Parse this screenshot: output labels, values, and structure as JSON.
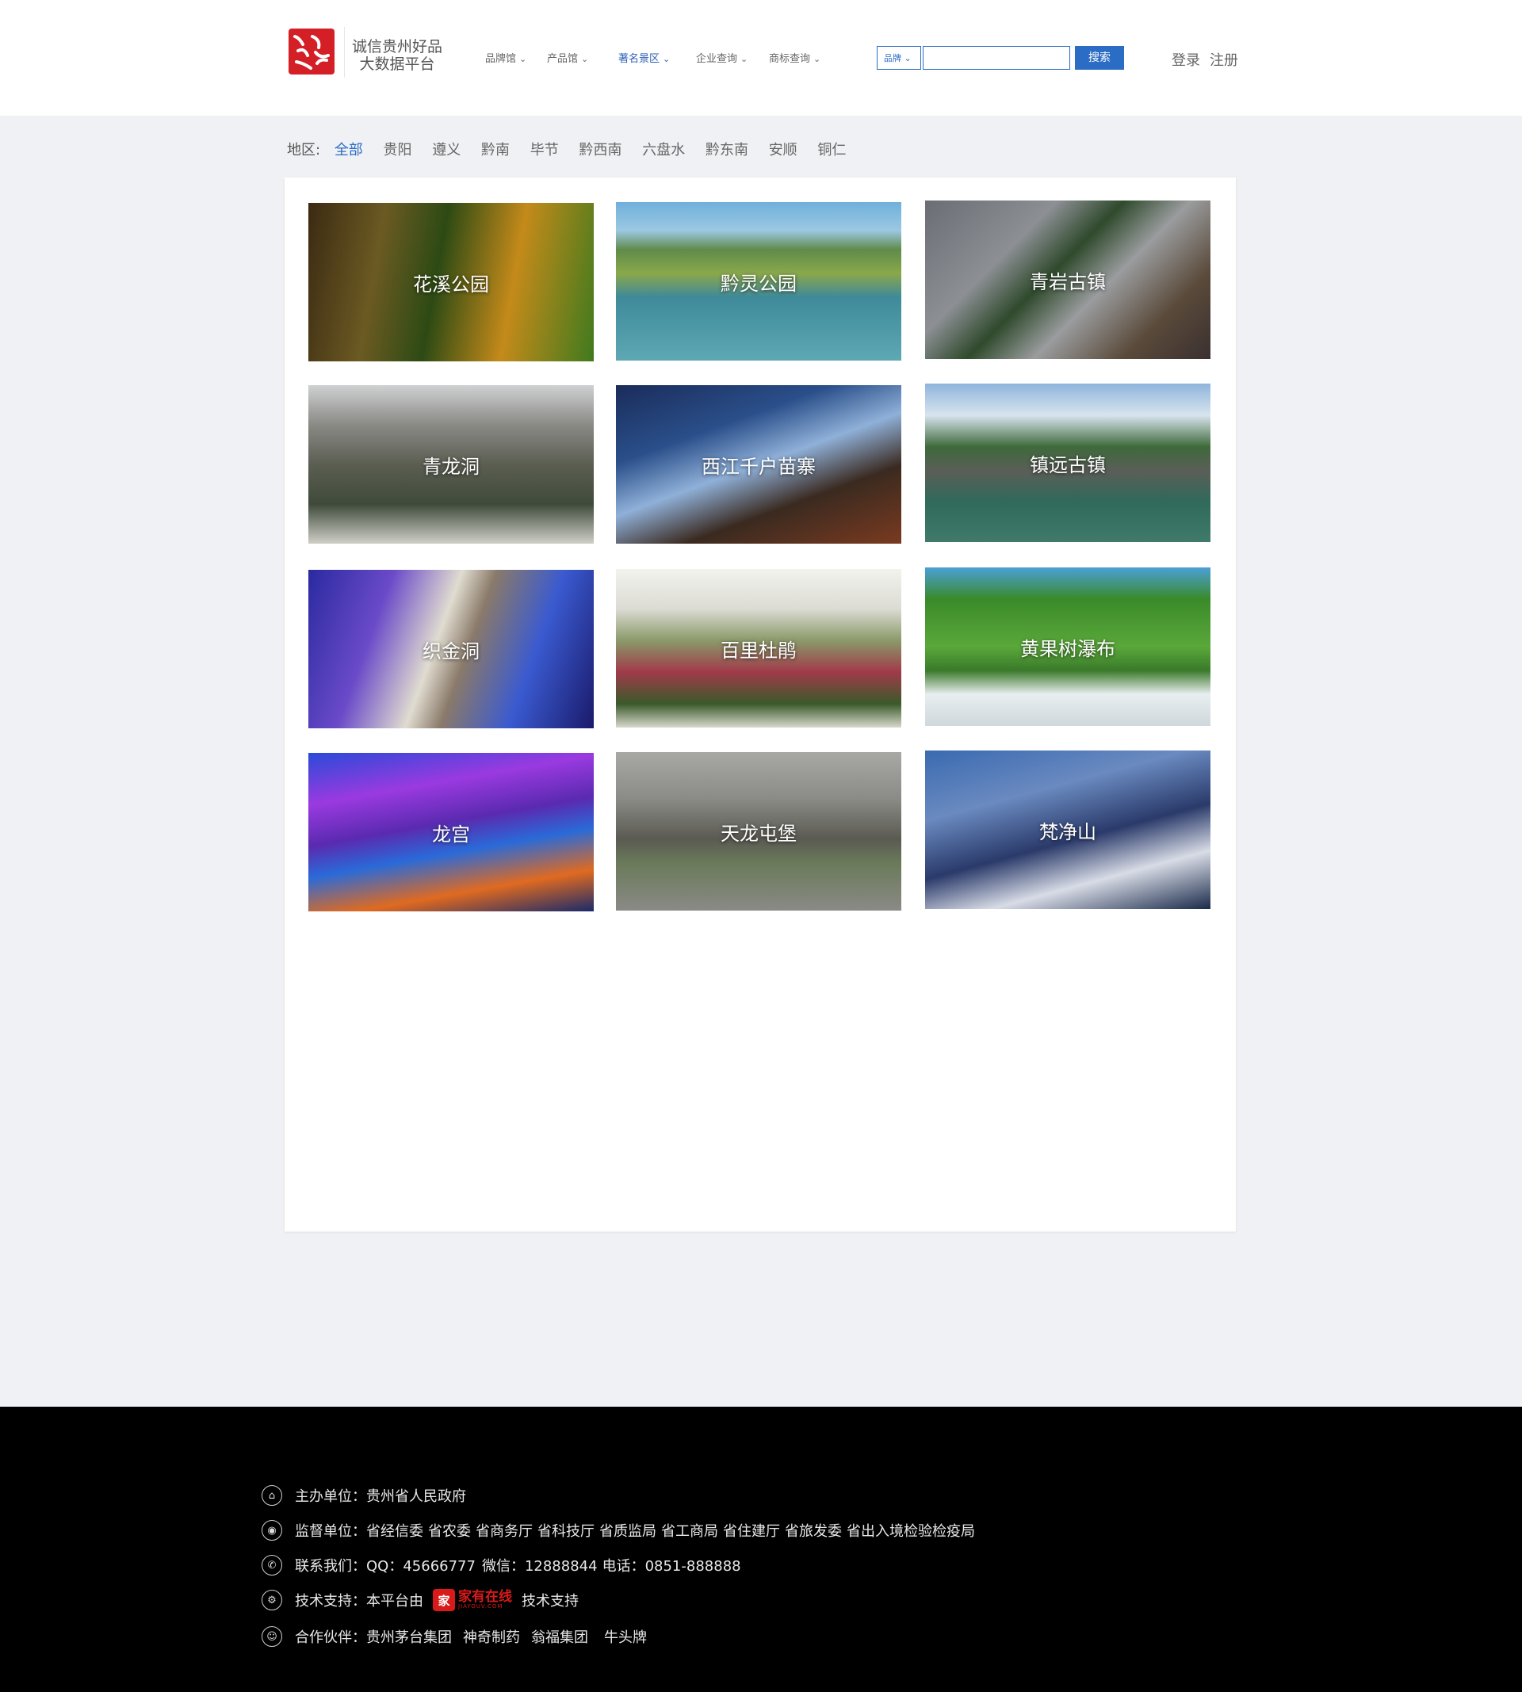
{
  "header": {
    "logo_text_line1": "诚信贵州好品",
    "logo_text_line2": "大数据平台",
    "nav": [
      {
        "label": "品牌馆",
        "active": false
      },
      {
        "label": "产品馆",
        "active": false
      },
      {
        "label": "著名景区",
        "active": true
      },
      {
        "label": "企业查询",
        "active": false
      },
      {
        "label": "商标查询",
        "active": false
      }
    ],
    "search": {
      "select_value": "品牌",
      "placeholder": "",
      "button": "搜索"
    },
    "auth": {
      "login": "登录",
      "register": "注册"
    }
  },
  "filter": {
    "label": "地区:",
    "options": [
      "全部",
      "贵阳",
      "遵义",
      "黔南",
      "毕节",
      "黔西南",
      "六盘水",
      "黔东南",
      "安顺",
      "铜仁"
    ],
    "active": "全部"
  },
  "scenic_spots": [
    {
      "name": "花溪公园",
      "image": "forest"
    },
    {
      "name": "黔灵公园",
      "image": "lake"
    },
    {
      "name": "青岩古镇",
      "image": "old-town"
    },
    {
      "name": "青龙洞",
      "image": "temple-cliff"
    },
    {
      "name": "西江千户苗寨",
      "image": "village-night"
    },
    {
      "name": "镇远古镇",
      "image": "river-town"
    },
    {
      "name": "织金洞",
      "image": "cave"
    },
    {
      "name": "百里杜鹃",
      "image": "flowers"
    },
    {
      "name": "黄果树瀑布",
      "image": "waterfall"
    },
    {
      "name": "龙宫",
      "image": "water-cave"
    },
    {
      "name": "天龙屯堡",
      "image": "stone-gate"
    },
    {
      "name": "梵净山",
      "image": "mountain"
    }
  ],
  "footer": {
    "host": {
      "label": "主办单位：",
      "value": "贵州省人民政府"
    },
    "supervisor": {
      "label": "监督单位：",
      "values": [
        "省经信委",
        "省农委",
        "省商务厅",
        "省科技厅",
        "省质监局",
        "省工商局",
        "省住建厅",
        "省旅发委",
        "省出入境检验检疫局"
      ]
    },
    "contact": {
      "label": "联系我们：",
      "qq": "QQ：45666777",
      "wechat": "微信：12888844",
      "phone": "电话：0851-888888"
    },
    "tech": {
      "label": "技术支持：本平台由",
      "brand": "家有在线",
      "brand_sub": "JIAYOUV.COM",
      "suffix": "技术支持"
    },
    "partners": {
      "label": "合作伙伴：",
      "values": [
        "贵州茅台集团",
        "神奇制药",
        "翁福集团",
        "牛头牌"
      ]
    }
  }
}
